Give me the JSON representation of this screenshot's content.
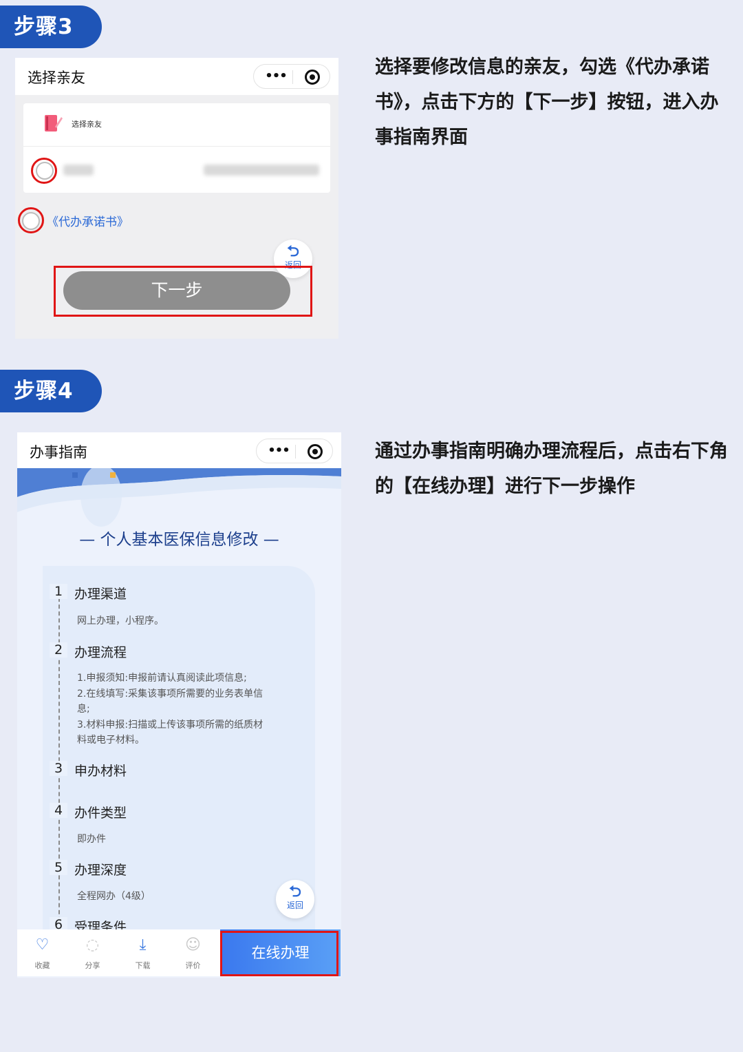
{
  "step3": {
    "badge": "步骤3",
    "description": "选择要修改信息的亲友，勾选《代办承诺书》，点击下方的【下一步】按钮，进入办事指南界面",
    "screen": {
      "title": "选择亲友",
      "menu_icon": "more-dots-icon",
      "close_icon": "target-icon",
      "card_header": "选择亲友",
      "agreement_link": "《代办承诺书》",
      "back_label": "返回",
      "next_button": "下一步"
    }
  },
  "step4": {
    "badge": "步骤4",
    "description": "通过办事指南明确办理流程后，点击右下角的【在线办理】进行下一步操作",
    "screen": {
      "title": "办事指南",
      "heading": "— 个人基本医保信息修改 —",
      "steps": [
        {
          "num": "1",
          "title": "办理渠道",
          "text": "网上办理，小程序。"
        },
        {
          "num": "2",
          "title": "办理流程",
          "text_lines": [
            "1.申报须知:申报前请认真阅读此项信息;",
            "2.在线填写:采集该事项所需要的业务表单信",
            "息;",
            "3.材料申报:扫描或上传该事项所需的纸质材",
            "料或电子材料。"
          ]
        },
        {
          "num": "3",
          "title": "申办材料",
          "text": ""
        },
        {
          "num": "4",
          "title": "办件类型",
          "text": "即办件"
        },
        {
          "num": "5",
          "title": "办理深度",
          "text": "全程网办（4级）"
        },
        {
          "num": "6",
          "title": "受理条件",
          "text": ""
        }
      ],
      "back_label": "返回",
      "tabs": [
        {
          "label": "收藏",
          "icon": "heart-icon"
        },
        {
          "label": "分享",
          "icon": "share-icon"
        },
        {
          "label": "下载",
          "icon": "download-icon"
        },
        {
          "label": "评价",
          "icon": "smile-icon"
        }
      ],
      "primary_button": "在线办理"
    }
  },
  "colors": {
    "page_bg": "#e8ebf6",
    "badge_bg": "#1f55b7",
    "highlight_red": "#e01515",
    "link_blue": "#2a68d6",
    "primary_gradient_from": "#3a78ee",
    "primary_gradient_to": "#5aa0f6"
  }
}
